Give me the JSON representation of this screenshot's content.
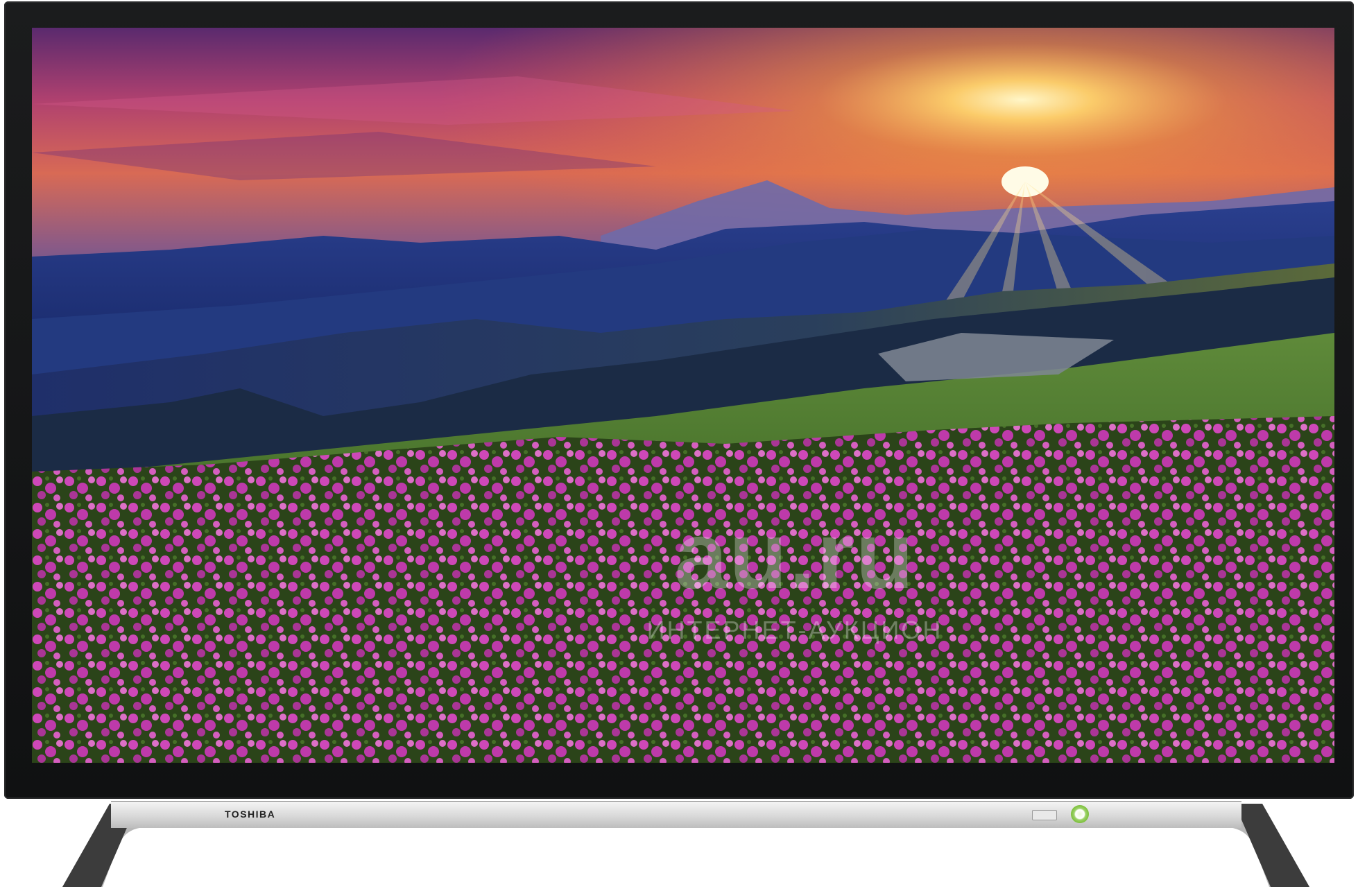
{
  "product": {
    "brand": "TOSHIBA",
    "type": "led-tv"
  },
  "screen_scene": {
    "subject": "mountain-sunset-with-pink-flowers"
  },
  "watermark": {
    "logo": "au.ru",
    "tagline": "ИНТЕРНЕТ-АУКЦИОН"
  },
  "colors": {
    "bezel": "#111213",
    "stand_silver": "#c8c8c8",
    "led": "#7bbf3a"
  }
}
